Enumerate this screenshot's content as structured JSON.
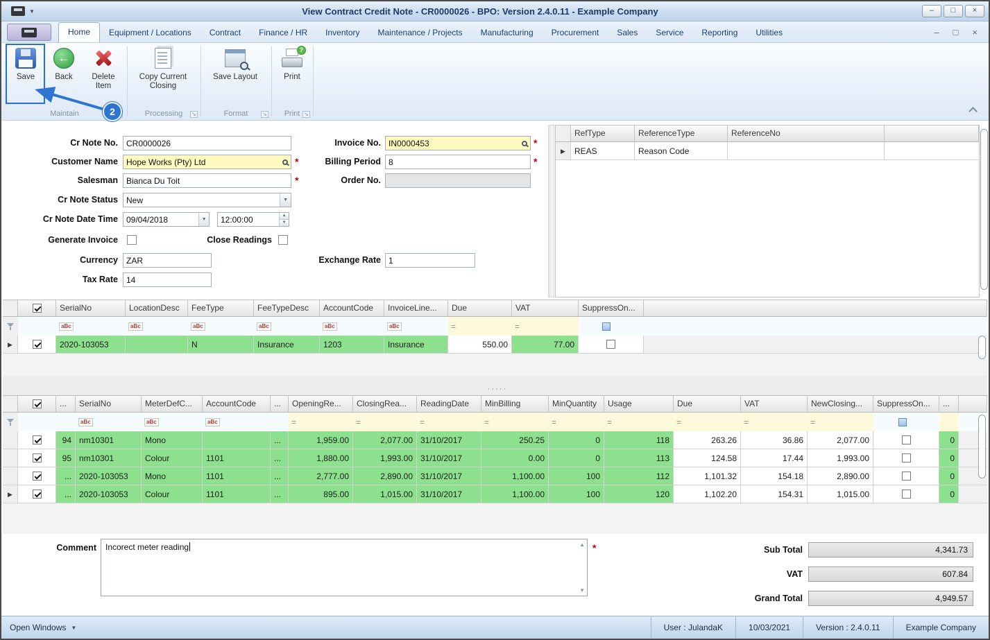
{
  "window": {
    "title": "View Contract Credit Note  - CR0000026 - BPO: Version 2.4.0.11 - Example Company"
  },
  "glyphs": {
    "minimize": "–",
    "maximize": "□",
    "close": "×",
    "required": "*",
    "dropdown": "▼",
    "spin_up": "▲",
    "spin_down": "▼",
    "row_arrow": "▶",
    "equals": "=",
    "abc": "aBc",
    "back_arrow": "←",
    "question": "?",
    "launcher": "↘",
    "grip": "·····"
  },
  "ribbon": {
    "tabs": [
      "Home",
      "Equipment / Locations",
      "Contract",
      "Finance / HR",
      "Inventory",
      "Maintenance / Projects",
      "Manufacturing",
      "Procurement",
      "Sales",
      "Service",
      "Reporting",
      "Utilities"
    ],
    "buttons": {
      "save": "Save",
      "back": "Back",
      "delete_item": "Delete Item",
      "copy_current_closing": "Copy Current Closing",
      "save_layout": "Save Layout",
      "print": "Print"
    },
    "groups": {
      "maintain": "Maintain",
      "processing": "Processing",
      "format": "Format",
      "print": "Print"
    },
    "callout_step": "2"
  },
  "form": {
    "cr_note_no": {
      "label": "Cr Note No.",
      "value": "CR0000026"
    },
    "customer_name": {
      "label": "Customer Name",
      "value": "Hope Works (Pty) Ltd"
    },
    "salesman": {
      "label": "Salesman",
      "value": "Bianca Du Toit"
    },
    "cr_note_status": {
      "label": "Cr Note Status",
      "value": "New"
    },
    "cr_note_date_time": {
      "label": "Cr Note Date Time",
      "date": "09/04/2018",
      "time": "12:00:00"
    },
    "generate_invoice": {
      "label": "Generate Invoice"
    },
    "close_readings": {
      "label": "Close Readings"
    },
    "currency": {
      "label": "Currency",
      "value": "ZAR"
    },
    "tax_rate": {
      "label": "Tax Rate",
      "value": "14"
    },
    "invoice_no": {
      "label": "Invoice No.",
      "value": "IN0000453"
    },
    "billing_period": {
      "label": "Billing Period",
      "value": "8"
    },
    "order_no": {
      "label": "Order No.",
      "value": ""
    },
    "exchange_rate": {
      "label": "Exchange Rate",
      "value": "1"
    }
  },
  "ref_grid": {
    "headers": [
      "RefType",
      "ReferenceType",
      "ReferenceNo"
    ],
    "rows": [
      {
        "cells": [
          "REAS",
          "Reason Code",
          ""
        ]
      }
    ]
  },
  "fees_grid": {
    "headers": [
      "SerialNo",
      "LocationDesc",
      "FeeType",
      "FeeTypeDesc",
      "AccountCode",
      "InvoiceLine...",
      "Due",
      "VAT",
      "SuppressOn..."
    ],
    "rows": [
      {
        "cells": [
          "2020-103053",
          "",
          "N",
          "Insurance",
          "1203",
          "Insurance",
          "550.00",
          "77.00"
        ]
      }
    ]
  },
  "meters_grid": {
    "headers": [
      "...",
      "SerialNo",
      "MeterDefC...",
      "AccountCode",
      "...",
      "OpeningRe...",
      "ClosingRea...",
      "ReadingDate",
      "MinBilling",
      "MinQuantity",
      "Usage",
      "Due",
      "VAT",
      "NewClosing...",
      "SuppressOn...",
      "..."
    ],
    "rows": [
      {
        "cells": [
          "94",
          "nm10301",
          "Mono",
          "",
          "...",
          "1,959.00",
          "2,077.00",
          "31/10/2017",
          "250.25",
          "0",
          "118",
          "263.26",
          "36.86",
          "2,077.00",
          "0"
        ]
      },
      {
        "cells": [
          "95",
          "nm10301",
          "Colour",
          "1101",
          "...",
          "1,880.00",
          "1,993.00",
          "31/10/2017",
          "0.00",
          "0",
          "113",
          "124.58",
          "17.44",
          "1,993.00",
          "0"
        ]
      },
      {
        "cells": [
          "...",
          "2020-103053",
          "Mono",
          "1101",
          "...",
          "2,777.00",
          "2,890.00",
          "31/10/2017",
          "1,100.00",
          "100",
          "112",
          "1,101.32",
          "154.18",
          "2,890.00",
          "0"
        ]
      },
      {
        "cells": [
          "...",
          "2020-103053",
          "Colour",
          "1101",
          "...",
          "895.00",
          "1,015.00",
          "31/10/2017",
          "1,100.00",
          "100",
          "120",
          "1,102.20",
          "154.31",
          "1,015.00",
          "0"
        ]
      }
    ]
  },
  "comment": {
    "label": "Comment",
    "value": "Incorect meter reading"
  },
  "totals": {
    "sub_total_label": "Sub Total",
    "sub_total_value": "4,341.73",
    "vat_label": "VAT",
    "vat_value": "607.84",
    "grand_total_label": "Grand Total",
    "grand_total_value": "4,949.57"
  },
  "statusbar": {
    "open_windows": "Open Windows",
    "user": "User : JulandaK",
    "date": "10/03/2021",
    "version": "Version : 2.4.0.11",
    "company": "Example Company"
  }
}
